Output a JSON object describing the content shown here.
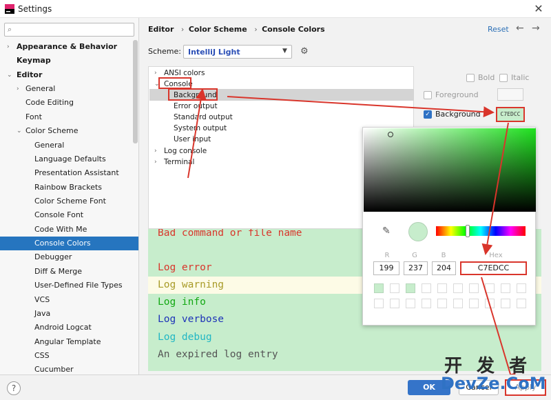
{
  "window": {
    "title": "Settings",
    "close": "✕"
  },
  "search": {
    "icon": "search-icon",
    "placeholder": ""
  },
  "sidebar": {
    "items": [
      {
        "label": "Appearance & Behavior",
        "chevron": "›",
        "bold": true
      },
      {
        "label": "Keymap",
        "chevron": "",
        "bold": true
      },
      {
        "label": "Editor",
        "chevron": "⌄",
        "bold": true
      },
      {
        "label": "General",
        "chevron": "›"
      },
      {
        "label": "Code Editing",
        "chevron": ""
      },
      {
        "label": "Font",
        "chevron": ""
      },
      {
        "label": "Color Scheme",
        "chevron": "⌄"
      },
      {
        "label": "General",
        "chevron": ""
      },
      {
        "label": "Language Defaults",
        "chevron": ""
      },
      {
        "label": "Presentation Assistant",
        "chevron": ""
      },
      {
        "label": "Rainbow Brackets",
        "chevron": ""
      },
      {
        "label": "Color Scheme Font",
        "chevron": ""
      },
      {
        "label": "Console Font",
        "chevron": ""
      },
      {
        "label": "Code With Me",
        "chevron": ""
      },
      {
        "label": "Console Colors",
        "chevron": "",
        "selected": true
      },
      {
        "label": "Debugger",
        "chevron": ""
      },
      {
        "label": "Diff & Merge",
        "chevron": ""
      },
      {
        "label": "User-Defined File Types",
        "chevron": ""
      },
      {
        "label": "VCS",
        "chevron": ""
      },
      {
        "label": "Java",
        "chevron": ""
      },
      {
        "label": "Android Logcat",
        "chevron": ""
      },
      {
        "label": "Angular Template",
        "chevron": ""
      },
      {
        "label": "CSS",
        "chevron": ""
      },
      {
        "label": "Cucumber",
        "chevron": ""
      }
    ]
  },
  "breadcrumb": {
    "items": [
      "Editor",
      "Color Scheme",
      "Console Colors"
    ],
    "sep": "›"
  },
  "header": {
    "reset": "Reset",
    "back": "←",
    "forward": "→"
  },
  "scheme": {
    "label": "Scheme:",
    "value": "IntelliJ Light",
    "caret": "▼",
    "gear": "⚙"
  },
  "tree": {
    "items": [
      {
        "label": "ANSI colors",
        "chevron": "›"
      },
      {
        "label": "Console",
        "chevron": "⌄"
      },
      {
        "label": "Background",
        "chevron": ""
      },
      {
        "label": "Error output",
        "chevron": ""
      },
      {
        "label": "Standard output",
        "chevron": ""
      },
      {
        "label": "System output",
        "chevron": ""
      },
      {
        "label": "User input",
        "chevron": ""
      },
      {
        "label": "Log console",
        "chevron": "›"
      },
      {
        "label": "Terminal",
        "chevron": "›"
      }
    ]
  },
  "options": {
    "bold": "Bold",
    "italic": "Italic",
    "foreground": "Foreground",
    "background": "Background",
    "background_checked": true,
    "background_swatch": "C7EDCC",
    "check": "✓"
  },
  "preview": {
    "lines": [
      {
        "text": "Bad command or file name",
        "color": "#d9352b",
        "bg": ""
      },
      {
        "text": "",
        "color": "#000000",
        "bg": ""
      },
      {
        "text": "Log error",
        "color": "#d9352b",
        "bg": ""
      },
      {
        "text": "Log warning",
        "color": "#a89b28",
        "bg": "#fdfbe6"
      },
      {
        "text": "Log info",
        "color": "#13a813",
        "bg": ""
      },
      {
        "text": "Log verbose",
        "color": "#1e33b8",
        "bg": ""
      },
      {
        "text": "Log debug",
        "color": "#22b7c4",
        "bg": ""
      },
      {
        "text": "An expired log entry",
        "color": "#555555",
        "bg": ""
      }
    ]
  },
  "picker": {
    "pipette": "✎",
    "labels": {
      "r": "R",
      "g": "G",
      "b": "B",
      "hex": "Hex"
    },
    "values": {
      "r": "199",
      "g": "237",
      "b": "204",
      "hex": "C7EDCC"
    },
    "filled_swatches": [
      0,
      2
    ]
  },
  "buttons": {
    "help": "?",
    "ok": "OK",
    "cancel": "Cancel",
    "apply": "Apply"
  },
  "watermark": {
    "line1": "开 发 者",
    "line2": "DevZe.CoM"
  }
}
